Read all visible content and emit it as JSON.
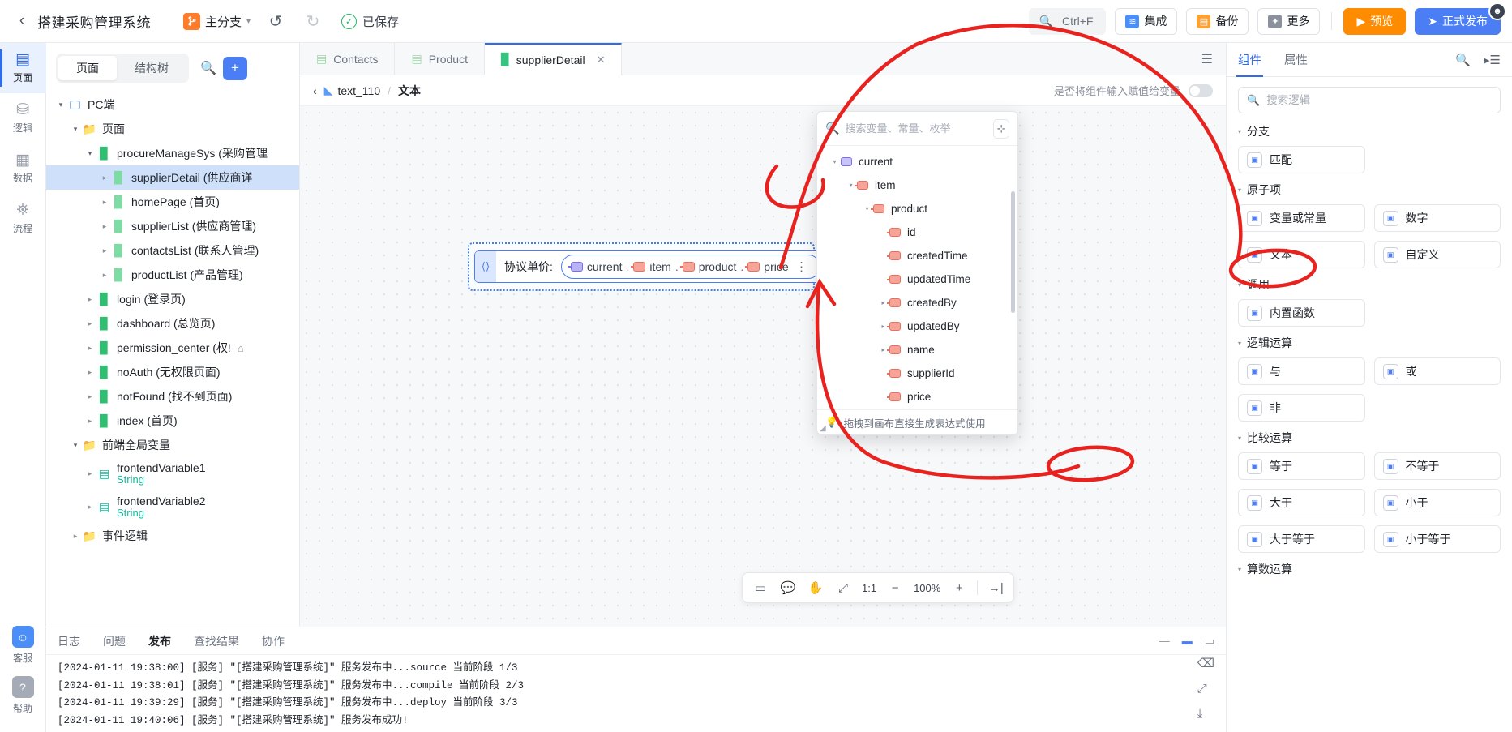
{
  "header": {
    "back_icon": "chevron-left",
    "title": "搭建采购管理系统",
    "branch": {
      "icon_label": "分",
      "name": "主分支"
    },
    "undo_icon": "undo",
    "redo_icon": "redo",
    "saved_label": "已保存",
    "search_shortcut": "Ctrl+F",
    "integration_label": "集成",
    "backup_label": "备份",
    "more_label": "更多",
    "preview_label": "预览",
    "publish_label": "正式发布"
  },
  "rail": {
    "items": [
      {
        "label": "页面",
        "icon": "pages-icon",
        "active": true
      },
      {
        "label": "逻辑",
        "icon": "logic-icon",
        "active": false
      },
      {
        "label": "数据",
        "icon": "data-icon",
        "active": false
      },
      {
        "label": "流程",
        "icon": "flow-icon",
        "active": false
      }
    ],
    "bottom": [
      {
        "label": "客服",
        "icon": "customer-service-icon"
      },
      {
        "label": "帮助",
        "icon": "help-icon"
      }
    ]
  },
  "left_panel": {
    "tabs": [
      {
        "label": "页面",
        "active": true
      },
      {
        "label": "结构树",
        "active": false
      }
    ],
    "search_icon": "search-icon",
    "add_label": "+",
    "tree": [
      {
        "indent": 0,
        "arrow": "open",
        "icon": "monitor",
        "label": "PC端"
      },
      {
        "indent": 1,
        "arrow": "open",
        "icon": "folder",
        "label": "页面"
      },
      {
        "indent": 2,
        "arrow": "open",
        "icon": "page",
        "label": "procureManageSys (采购管理"
      },
      {
        "indent": 3,
        "arrow": "closed",
        "icon": "page-l",
        "label": "supplierDetail (供应商详",
        "selected": true
      },
      {
        "indent": 3,
        "arrow": "closed",
        "icon": "page-l",
        "label": "homePage (首页)"
      },
      {
        "indent": 3,
        "arrow": "closed",
        "icon": "page-l",
        "label": "supplierList (供应商管理)"
      },
      {
        "indent": 3,
        "arrow": "closed",
        "icon": "page-l",
        "label": "contactsList (联系人管理)"
      },
      {
        "indent": 3,
        "arrow": "closed",
        "icon": "page-l",
        "label": "productList (产品管理)"
      },
      {
        "indent": 2,
        "arrow": "closed",
        "icon": "page",
        "label": "login (登录页)"
      },
      {
        "indent": 2,
        "arrow": "closed",
        "icon": "page",
        "label": "dashboard (总览页)"
      },
      {
        "indent": 2,
        "arrow": "closed",
        "icon": "page",
        "label": "permission_center (权!",
        "home": true
      },
      {
        "indent": 2,
        "arrow": "closed",
        "icon": "page",
        "label": "noAuth (无权限页面)"
      },
      {
        "indent": 2,
        "arrow": "closed",
        "icon": "page",
        "label": "notFound (找不到页面)"
      },
      {
        "indent": 2,
        "arrow": "closed",
        "icon": "page",
        "label": "index (首页)"
      },
      {
        "indent": 1,
        "arrow": "open",
        "icon": "folder",
        "label": "前端全局变量"
      },
      {
        "indent": 2,
        "arrow": "closed",
        "icon": "var",
        "label": "frontendVariable1",
        "sub": "String"
      },
      {
        "indent": 2,
        "arrow": "closed",
        "icon": "var",
        "label": "frontendVariable2",
        "sub": "String"
      },
      {
        "indent": 1,
        "arrow": "closed",
        "icon": "folder",
        "label": "事件逻辑"
      }
    ]
  },
  "center": {
    "tabs": [
      {
        "label": "Contacts",
        "icon": "grid-icon",
        "active": false
      },
      {
        "label": "Product",
        "icon": "grid-icon",
        "active": false
      },
      {
        "label": "supplierDetail",
        "icon": "page-icon",
        "active": true,
        "closable": true
      }
    ],
    "tabbar_menu_icon": "list-icon",
    "breadcrumb": {
      "back_icon": "chevron-left",
      "node_icon": "text-node-icon",
      "node_name": "text_110",
      "separator": "/",
      "current": "文本"
    },
    "assign_toggle_label": "是否将组件输入赋值给变量",
    "assign_toggle_state": "off",
    "expression": {
      "grip_icon": "text-handle-icon",
      "label": "协议单价:",
      "chips": [
        {
          "name": "current",
          "color": "purple"
        },
        {
          "name": "item",
          "color": "red"
        },
        {
          "name": "product",
          "color": "red"
        },
        {
          "name": "price",
          "color": "red"
        }
      ],
      "separator": ".",
      "more_icon": "more-vertical-icon"
    },
    "zoombar": {
      "frame_icon": "frame-icon",
      "comment_icon": "comment-icon",
      "hand_icon": "hand-icon",
      "fit_icon": "fit-icon",
      "ratio_label": "1:1",
      "minus_label": "−",
      "zoom_level": "100%",
      "plus_label": "+",
      "collapse_icon": "collapse-right-icon"
    }
  },
  "picker": {
    "search_placeholder": "搜索变量、常量、枚举",
    "search_icon": "search-icon",
    "add_icon": "add-variable-icon",
    "tree": [
      {
        "indent": 0,
        "arrow": "open",
        "color": "purple",
        "name": "current"
      },
      {
        "indent": 1,
        "arrow": "open",
        "color": "red",
        "name": "item"
      },
      {
        "indent": 2,
        "arrow": "open",
        "color": "red",
        "name": "product"
      },
      {
        "indent": 3,
        "arrow": "none",
        "color": "red",
        "name": "id"
      },
      {
        "indent": 3,
        "arrow": "none",
        "color": "red",
        "name": "createdTime"
      },
      {
        "indent": 3,
        "arrow": "none",
        "color": "red",
        "name": "updatedTime"
      },
      {
        "indent": 3,
        "arrow": "closed",
        "color": "red",
        "name": "createdBy"
      },
      {
        "indent": 3,
        "arrow": "closed",
        "color": "red",
        "name": "updatedBy"
      },
      {
        "indent": 3,
        "arrow": "closed",
        "color": "red",
        "name": "name"
      },
      {
        "indent": 3,
        "arrow": "none",
        "color": "red",
        "name": "supplierId"
      },
      {
        "indent": 3,
        "arrow": "none",
        "color": "red",
        "name": "price"
      }
    ],
    "footer_hint": "拖拽到画布直接生成表达式使用",
    "footer_icon": "bulb-icon"
  },
  "right_panel": {
    "tabs": [
      {
        "label": "组件",
        "active": true
      },
      {
        "label": "属性",
        "active": false
      }
    ],
    "search_icon": "search-icon",
    "layout_icon": "panel-collapse-icon",
    "search_placeholder": "搜索逻辑",
    "groups": [
      {
        "title": "分支",
        "items": [
          {
            "label": "匹配",
            "icon": "match-icon"
          }
        ]
      },
      {
        "title": "原子项",
        "items": [
          {
            "label": "变量或常量",
            "icon": "var-icon"
          },
          {
            "label": "数字",
            "icon": "number-icon"
          },
          {
            "label": "文本",
            "icon": "text-icon"
          },
          {
            "label": "自定义",
            "icon": "custom-icon"
          }
        ]
      },
      {
        "title": "调用",
        "items": [
          {
            "label": "内置函数",
            "icon": "function-icon"
          }
        ]
      },
      {
        "title": "逻辑运算",
        "items": [
          {
            "label": "与",
            "icon": "and-icon"
          },
          {
            "label": "或",
            "icon": "or-icon"
          },
          {
            "label": "非",
            "icon": "not-icon"
          }
        ]
      },
      {
        "title": "比较运算",
        "items": [
          {
            "label": "等于",
            "icon": "equal-icon"
          },
          {
            "label": "不等于",
            "icon": "not-equal-icon"
          },
          {
            "label": "大于",
            "icon": "greater-icon"
          },
          {
            "label": "小于",
            "icon": "less-icon"
          },
          {
            "label": "大于等于",
            "icon": "greater-equal-icon"
          },
          {
            "label": "小于等于",
            "icon": "less-equal-icon"
          }
        ]
      },
      {
        "title": "算数运算",
        "items": []
      }
    ]
  },
  "log_panel": {
    "tabs": [
      {
        "label": "日志",
        "active": false
      },
      {
        "label": "问题",
        "active": false
      },
      {
        "label": "发布",
        "active": true
      },
      {
        "label": "查找结果",
        "active": false
      },
      {
        "label": "协作",
        "active": false
      }
    ],
    "window_icons": [
      "minimize-icon",
      "maximize-icon",
      "restore-icon"
    ],
    "lines": [
      "[2024-01-11 19:38:00] [服务] \"[搭建采购管理系统]\" 服务发布中...source 当前阶段 1/3",
      "[2024-01-11 19:38:01] [服务] \"[搭建采购管理系统]\" 服务发布中...compile 当前阶段 2/3",
      "[2024-01-11 19:39:29] [服务] \"[搭建采购管理系统]\" 服务发布中...deploy 当前阶段 3/3",
      "[2024-01-11 19:40:06] [服务] \"[搭建采购管理系统]\" 服务发布成功!"
    ],
    "side_icons": [
      "clear-icon",
      "expand-icon",
      "download-icon"
    ]
  },
  "colors": {
    "accent": "#2f6bed",
    "publish": "#4b7df5",
    "preview": "#ff8b00",
    "branch": "#ff7c2b",
    "saved": "#23b96a",
    "annotation": "#e8231f"
  }
}
